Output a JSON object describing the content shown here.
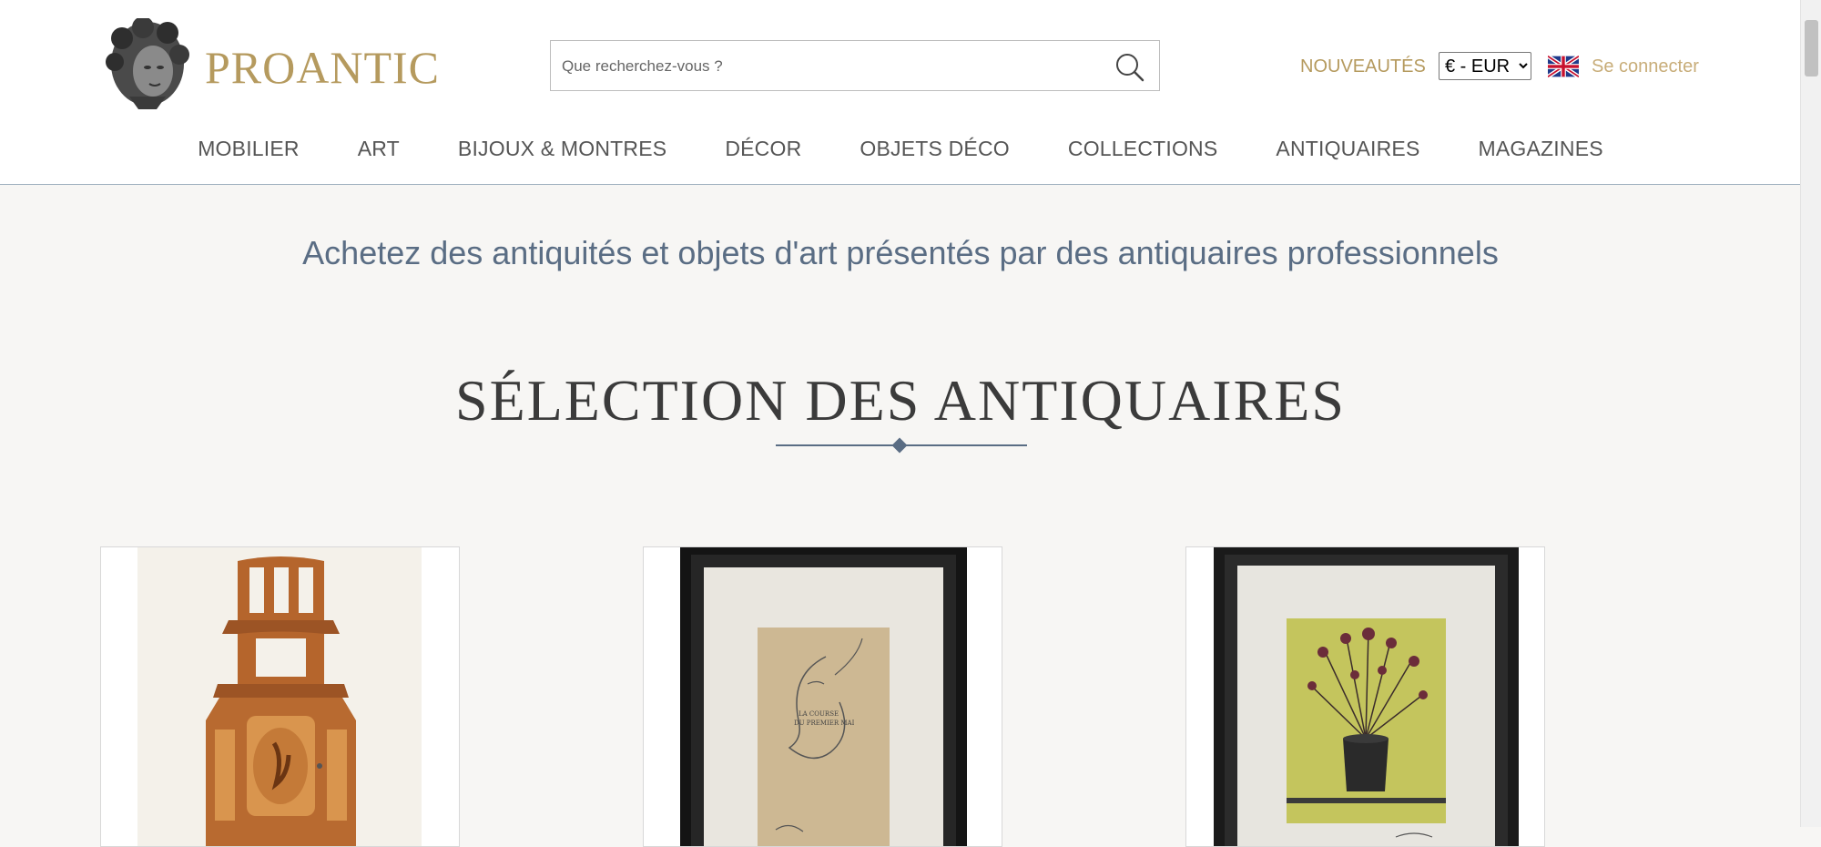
{
  "header": {
    "logo_text": "PROANTIC",
    "search": {
      "placeholder": "Que recherchez-vous ?"
    },
    "new_link": "NOUVEAUTÉS",
    "currency": {
      "selected": "€ - EUR"
    },
    "language_flag": "uk-flag-icon",
    "login_link": "Se connecter"
  },
  "nav": {
    "items": [
      {
        "label": "MOBILIER"
      },
      {
        "label": "ART"
      },
      {
        "label": "BIJOUX & MONTRES"
      },
      {
        "label": "DÉCOR"
      },
      {
        "label": "OBJETS DÉCO"
      },
      {
        "label": "COLLECTIONS"
      },
      {
        "label": "ANTIQUAIRES"
      },
      {
        "label": "MAGAZINES"
      }
    ]
  },
  "main": {
    "tagline": "Achetez des antiquités et objets d'art présentés par des antiquaires professionnels",
    "section_title": "SÉLECTION DES ANTIQUAIRES",
    "cards": [
      {
        "image": "corner-shelf-cabinet-image"
      },
      {
        "image": "framed-drawing-image"
      },
      {
        "image": "framed-flower-print-image"
      }
    ]
  },
  "colors": {
    "brand_gold": "#b59a5e",
    "accent_blue": "#5a6d84",
    "background": "#f7f6f4"
  }
}
